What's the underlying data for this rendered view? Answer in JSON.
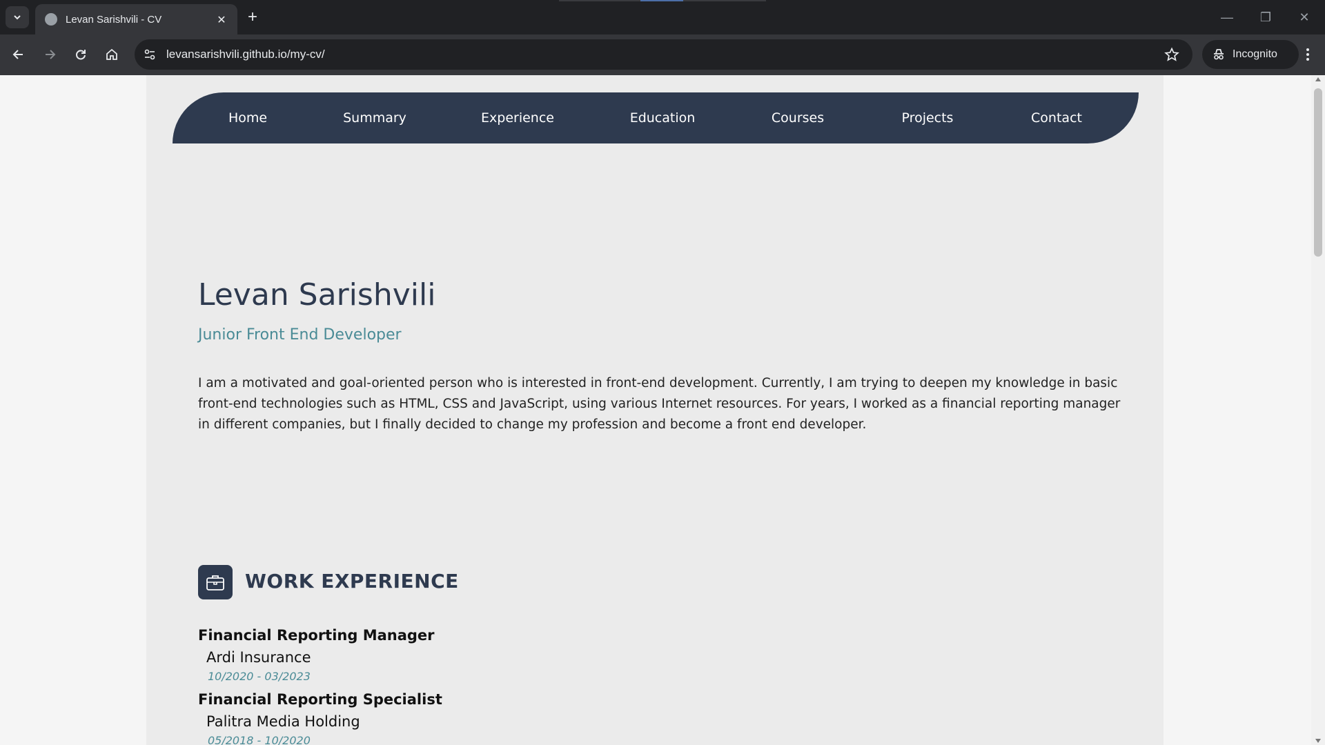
{
  "browser": {
    "tab_title": "Levan Sarishvili - CV",
    "url": "levansarishvili.github.io/my-cv/",
    "incognito_label": "Incognito"
  },
  "nav": {
    "items": [
      {
        "label": "Home"
      },
      {
        "label": "Summary"
      },
      {
        "label": "Experience"
      },
      {
        "label": "Education"
      },
      {
        "label": "Courses"
      },
      {
        "label": "Projects"
      },
      {
        "label": "Contact"
      }
    ]
  },
  "hero": {
    "name": "Levan Sarishvili",
    "role": "Junior Front End Developer",
    "intro": "I am a motivated and goal-oriented person who is interested in front-end development. Currently, I am trying to deepen my knowledge in basic front-end technologies such as HTML, CSS and JavaScript, using various Internet resources. For years, I worked as a financial reporting manager in different companies, but I finally decided to change my profession and become a front end developer."
  },
  "work": {
    "title": "WORK EXPERIENCE",
    "icon": "briefcase-icon",
    "jobs": [
      {
        "title": "Financial Reporting Manager",
        "company": "Ardi Insurance",
        "dates": "10/2020 - 03/2023"
      },
      {
        "title": "Financial Reporting Specialist",
        "company": "Palitra Media Holding",
        "dates": "05/2018 - 10/2020"
      }
    ]
  },
  "colors": {
    "navy": "#2e3a4f",
    "teal": "#4a8b96",
    "panel": "#ebebeb"
  }
}
